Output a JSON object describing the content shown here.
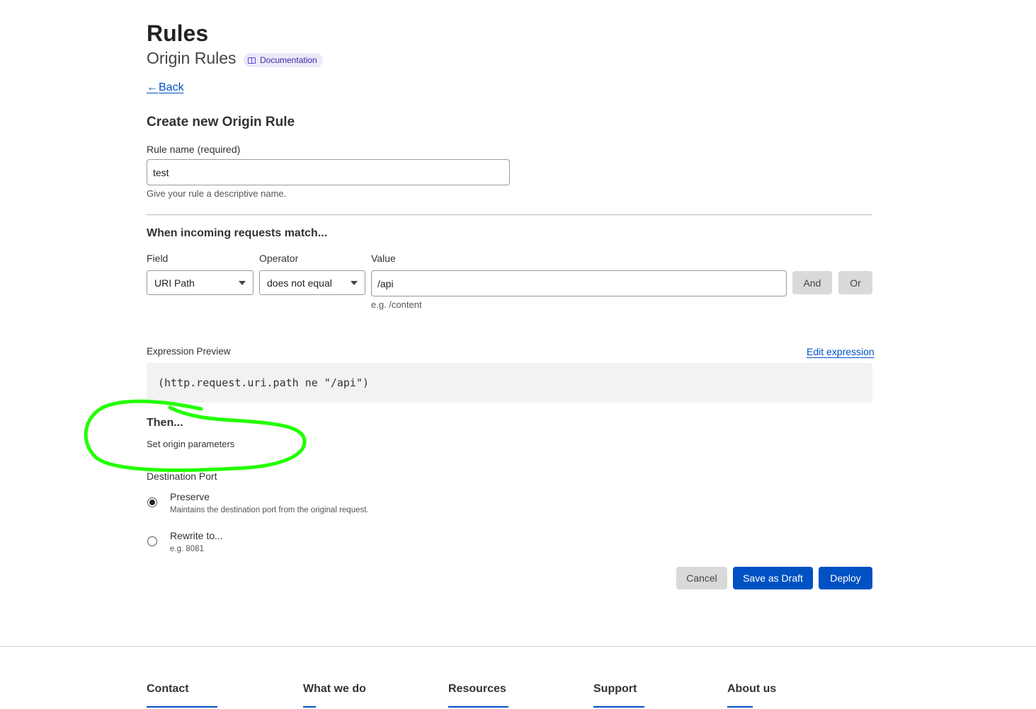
{
  "header": {
    "title": "Rules",
    "subtitle": "Origin Rules",
    "doc_badge": "Documentation",
    "back_label": "Back"
  },
  "form": {
    "section_title": "Create new Origin Rule",
    "rule_name_label": "Rule name (required)",
    "rule_name_value": "test",
    "rule_name_help": "Give your rule a descriptive name."
  },
  "match": {
    "title": "When incoming requests match...",
    "field_label": "Field",
    "operator_label": "Operator",
    "value_label": "Value",
    "field_value": "URI Path",
    "operator_value": "does not equal",
    "value_value": "/api",
    "value_help": "e.g. /content",
    "and_label": "And",
    "or_label": "Or"
  },
  "expression": {
    "label": "Expression Preview",
    "edit_label": "Edit expression",
    "code": "(http.request.uri.path ne \"/api\")"
  },
  "then": {
    "title": "Then...",
    "subtitle": "Set origin parameters",
    "dest_port_label": "Destination Port",
    "options": [
      {
        "label": "Preserve",
        "desc": "Maintains the destination port from the original request.",
        "checked": true
      },
      {
        "label": "Rewrite to...",
        "desc": "e.g. 8081",
        "checked": false
      }
    ]
  },
  "actions": {
    "cancel": "Cancel",
    "save_draft": "Save as Draft",
    "deploy": "Deploy"
  },
  "footer": {
    "columns": [
      "Contact",
      "What we do",
      "Resources",
      "Support",
      "About us"
    ]
  },
  "colors": {
    "primary": "#0051c3",
    "annotation": "#22ff00"
  }
}
